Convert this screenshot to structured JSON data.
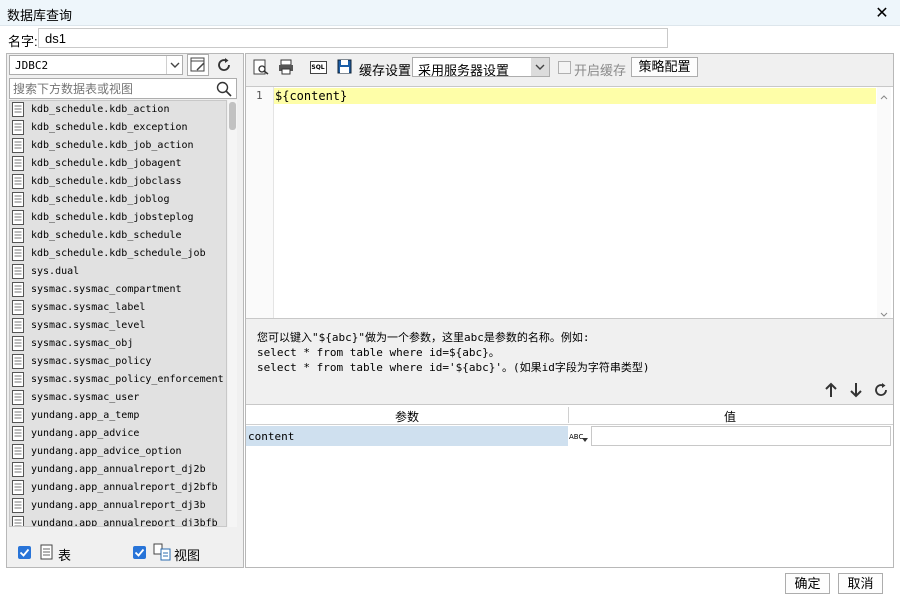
{
  "window": {
    "title": "数据库查询",
    "close_glyph": "✕"
  },
  "name_row": {
    "label": "名字:",
    "value": "ds1"
  },
  "left": {
    "connection": "JDBC2",
    "search_placeholder": "搜索下方数据表或视图",
    "tables": [
      "kdb_schedule.kdb_action",
      "kdb_schedule.kdb_exception",
      "kdb_schedule.kdb_job_action",
      "kdb_schedule.kdb_jobagent",
      "kdb_schedule.kdb_jobclass",
      "kdb_schedule.kdb_joblog",
      "kdb_schedule.kdb_jobsteplog",
      "kdb_schedule.kdb_schedule",
      "kdb_schedule.kdb_schedule_job",
      "sys.dual",
      "sysmac.sysmac_compartment",
      "sysmac.sysmac_label",
      "sysmac.sysmac_level",
      "sysmac.sysmac_obj",
      "sysmac.sysmac_policy",
      "sysmac.sysmac_policy_enforcement",
      "sysmac.sysmac_user",
      "yundang.app_a_temp",
      "yundang.app_advice",
      "yundang.app_advice_option",
      "yundang.app_annualreport_dj2b",
      "yundang.app_annualreport_dj2bfb",
      "yundang.app_annualreport_dj3b",
      "yundang.app_annualreport_dj3bfb"
    ],
    "filter_table_label": "表",
    "filter_view_label": "视图"
  },
  "toolbar": {
    "cache_label": "缓存设置",
    "cache_select": "采用服务器设置",
    "enable_cache_label": "开启缓存",
    "strategy_button": "策略配置",
    "sql_icon_text": "SQL"
  },
  "editor": {
    "line_number": "1",
    "code": "${content}"
  },
  "hint": {
    "line1": "您可以键入\"${abc}\"做为一个参数，这里abc是参数的名称。例如:",
    "line2": "select * from table where id=${abc}。",
    "line3": "select * from table where id='${abc}'。(如果id字段为字符串类型)"
  },
  "params": {
    "col_param": "参数",
    "col_value": "值",
    "rows": [
      {
        "name": "content",
        "type_icon": "ABC",
        "value": ""
      }
    ]
  },
  "footer": {
    "ok": "确定",
    "cancel": "取消"
  },
  "colors": {
    "title_bg": "#eef6fb",
    "selected_row": "#cfe0ef",
    "editor_line": "#fefea8",
    "list_bg": "#e1e1e1"
  }
}
